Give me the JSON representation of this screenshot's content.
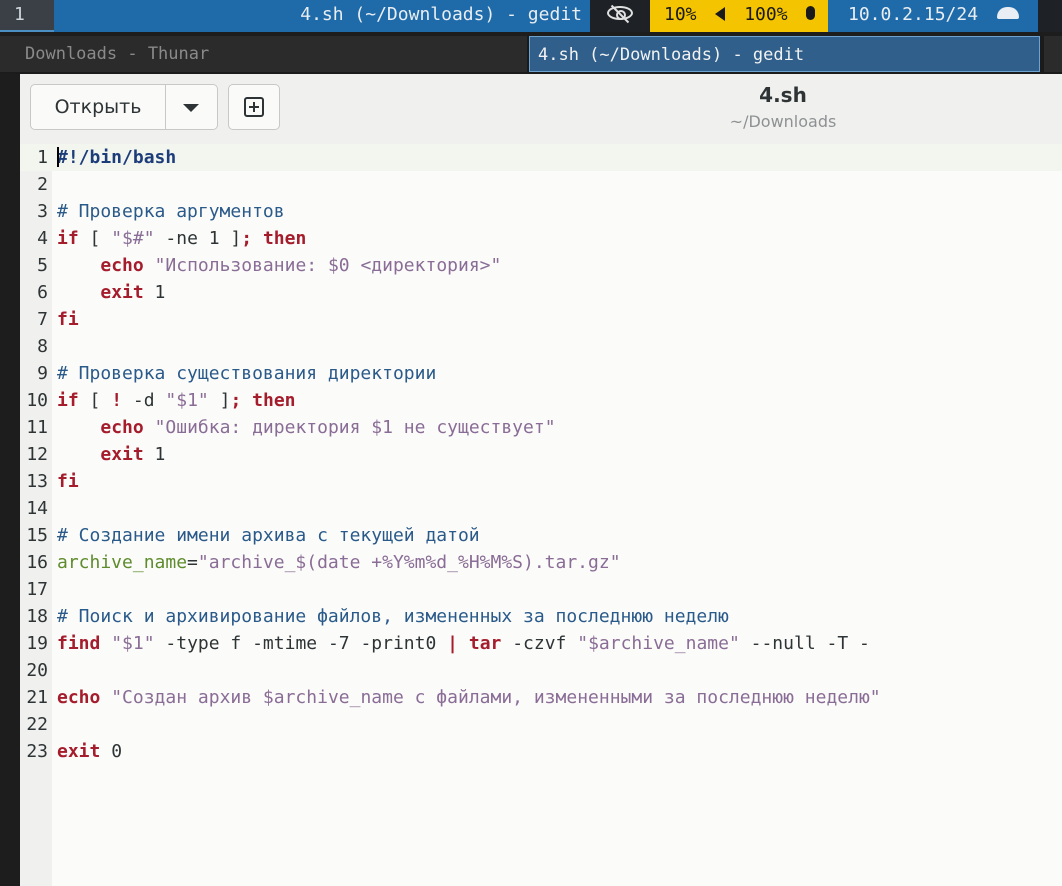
{
  "topbar": {
    "workspace": "1",
    "window_title": "4.sh (~/Downloads) - gedit",
    "brightness": "10%",
    "volume": "100%",
    "ip": "10.0.2.15/24",
    "icons": [
      "eye-off-icon",
      "speaker-icon",
      "microphone-icon",
      "network-icon"
    ],
    "colors": {
      "volume_bg": "#f5c400",
      "accent": "#1f6aa8"
    }
  },
  "tabs": [
    {
      "label": "Downloads - Thunar",
      "active": false
    },
    {
      "label": "4.sh (~/Downloads) - gedit",
      "active": true
    }
  ],
  "header": {
    "open_label": "Открыть",
    "title": "4.sh",
    "subtitle": "~/Downloads",
    "icons": [
      "chevron-down-icon",
      "new-document-icon"
    ]
  },
  "editor": {
    "language": "bash",
    "current_line": 1,
    "lines": [
      "#!/bin/bash",
      "",
      "# Проверка аргументов",
      "if [ \"$#\" -ne 1 ]; then",
      "    echo \"Использование: $0 <директория>\"",
      "    exit 1",
      "fi",
      "",
      "# Проверка существования директории",
      "if [ ! -d \"$1\" ]; then",
      "    echo \"Ошибка: директория $1 не существует\"",
      "    exit 1",
      "fi",
      "",
      "# Создание имени архива с текущей датой",
      "archive_name=\"archive_$(date +%Y%m%d_%H%M%S).tar.gz\"",
      "",
      "# Поиск и архивирование файлов, измененных за последнюю неделю",
      "find \"$1\" -type f -mtime -7 -print0 | tar -czvf \"$archive_name\" --null -T -",
      "",
      "echo \"Создан архив $archive_name с файлами, измененными за последнюю неделю\"",
      "",
      "exit 0"
    ]
  }
}
